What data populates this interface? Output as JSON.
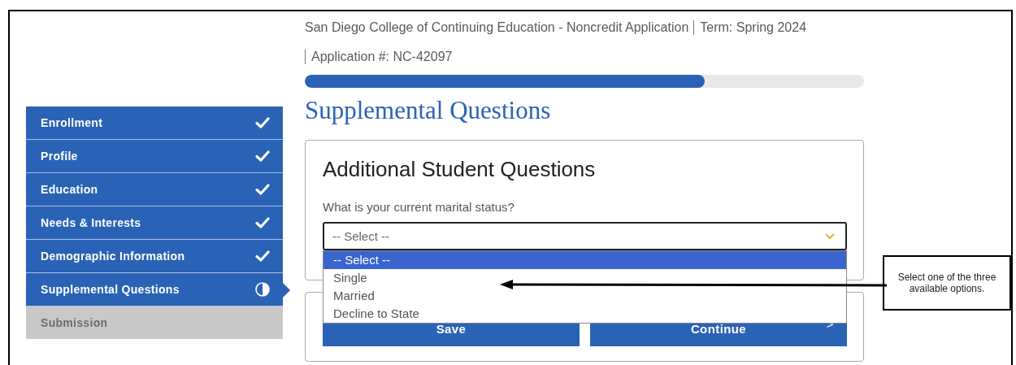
{
  "header": {
    "college": "San Diego College of Continuing Education - Noncredit Application",
    "term": "Term: Spring 2024",
    "application": "Application #: NC-42097"
  },
  "progress": {
    "level": 0.715
  },
  "sidebar": {
    "items": [
      {
        "label": "Enrollment",
        "kind": "complete",
        "selected": false
      },
      {
        "label": "Profile",
        "kind": "complete",
        "selected": false
      },
      {
        "label": "Education",
        "kind": "complete",
        "selected": false
      },
      {
        "label": "Needs & Interests",
        "kind": "complete",
        "selected": false
      },
      {
        "label": "Demographic Information",
        "kind": "complete",
        "selected": false
      },
      {
        "label": "Supplemental Questions",
        "kind": "in_progress",
        "selected": true
      },
      {
        "label": "Submission",
        "kind": "locked",
        "selected": false
      }
    ]
  },
  "page_title": "Supplemental Questions",
  "card": {
    "title": "Additional Student Questions",
    "question": "What is your current marital status?",
    "select": {
      "value": "-- Select --",
      "expanded": true,
      "options": [
        {
          "label": "-- Select --",
          "selected": true
        },
        {
          "label": "Single",
          "selected": false
        },
        {
          "label": "Married",
          "selected": false
        },
        {
          "label": "Decline to State",
          "selected": false
        }
      ]
    }
  },
  "buttons": [
    {
      "label": "Save"
    },
    {
      "label": "Continue",
      "icon": ">"
    }
  ],
  "callout": {
    "text": "Select one of the three available options."
  }
}
